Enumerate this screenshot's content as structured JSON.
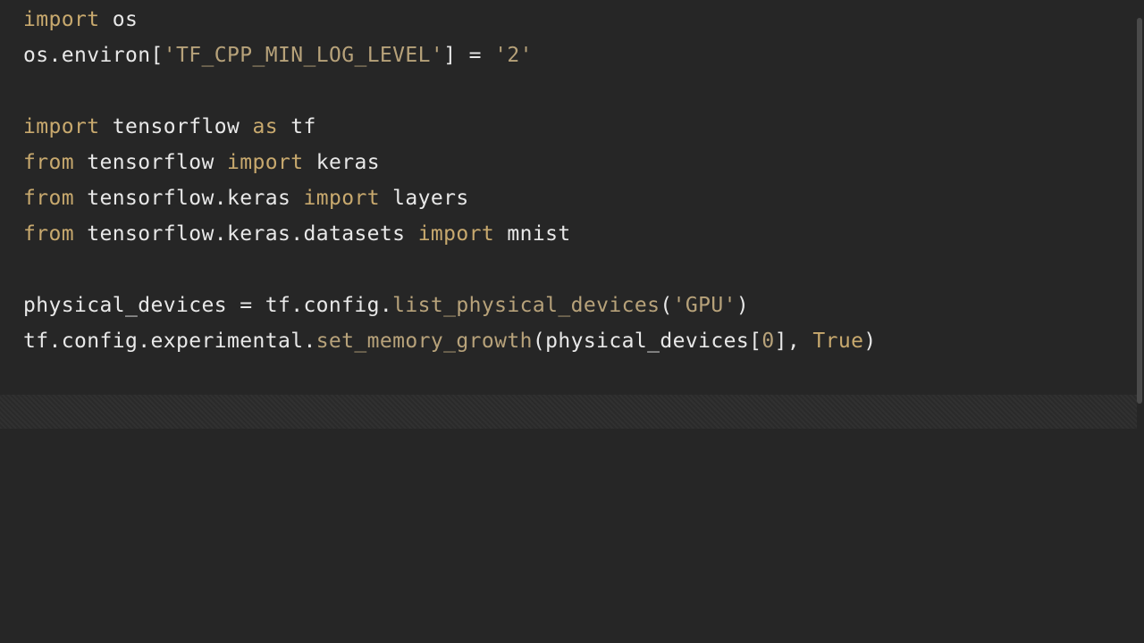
{
  "editor": {
    "lines": [
      [
        {
          "t": "import",
          "k": "keyword"
        },
        {
          "t": " os",
          "k": "plain"
        }
      ],
      [
        {
          "t": "os.environ[",
          "k": "plain"
        },
        {
          "t": "'TF_CPP_MIN_LOG_LEVEL'",
          "k": "string"
        },
        {
          "t": "] = ",
          "k": "plain"
        },
        {
          "t": "'2'",
          "k": "string"
        }
      ],
      [],
      [
        {
          "t": "import",
          "k": "keyword"
        },
        {
          "t": " tensorflow ",
          "k": "plain"
        },
        {
          "t": "as",
          "k": "keyword"
        },
        {
          "t": " tf",
          "k": "plain"
        }
      ],
      [
        {
          "t": "from",
          "k": "keyword"
        },
        {
          "t": " tensorflow ",
          "k": "plain"
        },
        {
          "t": "import",
          "k": "keyword"
        },
        {
          "t": " keras",
          "k": "plain"
        }
      ],
      [
        {
          "t": "from",
          "k": "keyword"
        },
        {
          "t": " tensorflow.keras ",
          "k": "plain"
        },
        {
          "t": "import",
          "k": "keyword"
        },
        {
          "t": " layers",
          "k": "plain"
        }
      ],
      [
        {
          "t": "from",
          "k": "keyword"
        },
        {
          "t": " tensorflow.keras.datasets ",
          "k": "plain"
        },
        {
          "t": "import",
          "k": "keyword"
        },
        {
          "t": " mnist",
          "k": "plain"
        }
      ],
      [],
      [
        {
          "t": "physical_devices = tf.config.",
          "k": "plain"
        },
        {
          "t": "list_physical_devices",
          "k": "func"
        },
        {
          "t": "(",
          "k": "plain"
        },
        {
          "t": "'GPU'",
          "k": "string"
        },
        {
          "t": ")",
          "k": "plain"
        }
      ],
      [
        {
          "t": "tf.config.experimental.",
          "k": "plain"
        },
        {
          "t": "set_memory_growth",
          "k": "func"
        },
        {
          "t": "(physical_devices[",
          "k": "plain"
        },
        {
          "t": "0",
          "k": "number"
        },
        {
          "t": "], ",
          "k": "plain"
        },
        {
          "t": "True",
          "k": "const"
        },
        {
          "t": ")",
          "k": "plain"
        }
      ]
    ]
  },
  "colors": {
    "background": "#262626",
    "keyword": "#c8a96e",
    "plain": "#e8e8e8",
    "string": "#b7a27a"
  }
}
